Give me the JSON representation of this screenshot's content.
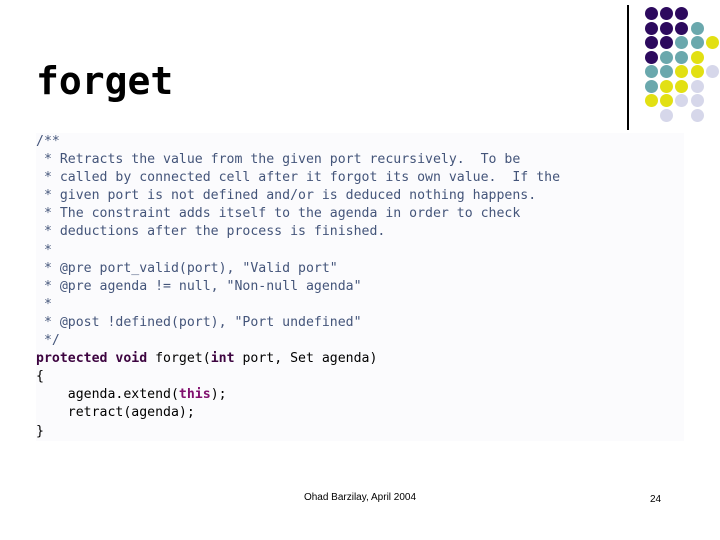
{
  "slide": {
    "title": "forget",
    "page_number": "24",
    "footer_credit": "Ohad Barzilay, April 2004"
  },
  "decoration": {
    "rule_color": "#000000",
    "palette": {
      "purple": "#2d0a5e",
      "teal": "#6aa8ad",
      "yellow": "#e2e013",
      "lavender": "#d6d7ea"
    },
    "dot_grid": [
      [
        "purple",
        "purple",
        "purple",
        "",
        ""
      ],
      [
        "purple",
        "purple",
        "purple",
        "teal",
        ""
      ],
      [
        "purple",
        "purple",
        "teal",
        "teal",
        "yellow"
      ],
      [
        "purple",
        "teal",
        "teal",
        "yellow",
        ""
      ],
      [
        "teal",
        "teal",
        "yellow",
        "yellow",
        "lavender"
      ],
      [
        "teal",
        "yellow",
        "yellow",
        "lavender",
        ""
      ],
      [
        "yellow",
        "yellow",
        "lavender",
        "lavender",
        ""
      ],
      [
        "",
        "lavender",
        "",
        "lavender",
        ""
      ]
    ]
  },
  "code": {
    "language": "java",
    "lines": [
      [
        {
          "t": "/**",
          "c": "comment"
        }
      ],
      [
        {
          "t": " * Retracts the value from the given port recursively.  To be",
          "c": "comment"
        }
      ],
      [
        {
          "t": " * called by connected cell after it forgot its own value.  If the",
          "c": "comment"
        }
      ],
      [
        {
          "t": " * given port is not defined and/or is deduced nothing happens.",
          "c": "comment"
        }
      ],
      [
        {
          "t": " * The constraint adds itself to the agenda in order to check",
          "c": "comment"
        }
      ],
      [
        {
          "t": " * deductions after the process is finished.",
          "c": "comment"
        }
      ],
      [
        {
          "t": " *",
          "c": "comment"
        }
      ],
      [
        {
          "t": " * @pre port_valid(port), \"Valid port\"",
          "c": "comment"
        }
      ],
      [
        {
          "t": " * @pre agenda != null, \"Non-null agenda\"",
          "c": "comment"
        }
      ],
      [
        {
          "t": " *",
          "c": "comment"
        }
      ],
      [
        {
          "t": " * @post !defined(port), \"Port undefined\"",
          "c": "comment"
        }
      ],
      [
        {
          "t": " */",
          "c": "comment"
        }
      ],
      [
        {
          "t": "protected void",
          "c": "kw"
        },
        {
          "t": " forget(",
          "c": "plain"
        },
        {
          "t": "int",
          "c": "kw"
        },
        {
          "t": " port, Set agenda)",
          "c": "plain"
        }
      ],
      [
        {
          "t": "{",
          "c": "plain"
        }
      ],
      [
        {
          "t": "    agenda.extend(",
          "c": "plain"
        },
        {
          "t": "this",
          "c": "this"
        },
        {
          "t": ");",
          "c": "plain"
        }
      ],
      [
        {
          "t": "    retract(agenda);",
          "c": "plain"
        }
      ],
      [
        {
          "t": "}",
          "c": "plain"
        }
      ]
    ]
  }
}
